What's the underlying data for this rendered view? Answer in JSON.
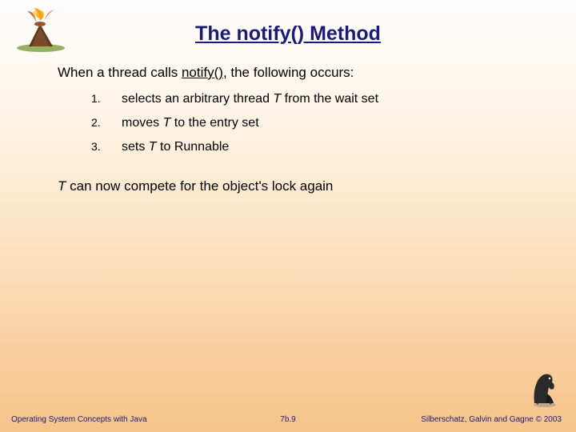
{
  "title": "The notify() Method",
  "intro_prefix": "When a thread calls ",
  "intro_underline": "notify()",
  "intro_suffix": ", the following occurs:",
  "list": [
    {
      "num": "1.",
      "text_pre": "selects an arbitrary thread ",
      "t": "T",
      "text_post": "  from the wait set"
    },
    {
      "num": "2.",
      "text_pre": "moves ",
      "t": "T",
      "text_post": "  to the entry set"
    },
    {
      "num": "3.",
      "text_pre": "sets ",
      "t": "T",
      "text_post": "  to Runnable"
    }
  ],
  "outro_t": "T",
  "outro_text": " can now compete for the object's lock again",
  "footer": {
    "left": "Operating System Concepts with Java",
    "center": "7b.9",
    "right": "Silberschatz, Galvin and Gagne © 2003"
  }
}
